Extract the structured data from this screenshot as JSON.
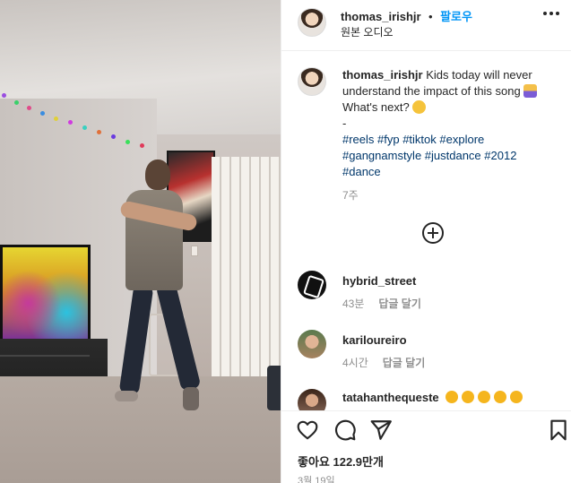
{
  "post": {
    "username": "thomas_irishjr",
    "follow_label": "팔로우",
    "audio_label": "원본 오디오"
  },
  "caption": {
    "username": "thomas_irishjr",
    "text_line1": "Kids today will never understand the impact of this song",
    "text_line2": "What's next?",
    "dash": "-",
    "hashtags": "#reels #fyp #tiktok #explore #gangnamstyle #justdance #2012 #dance",
    "time": "7주"
  },
  "comments": [
    {
      "username": "hybrid_street",
      "time": "43분",
      "reply_label": "답글 달기"
    },
    {
      "username": "kariloureiro",
      "time": "4시간",
      "reply_label": "답글 달기"
    },
    {
      "username": "tatahanthequeste",
      "time": "",
      "reply_label": ""
    }
  ],
  "actions": {
    "likes": "좋아요 122.9만개",
    "date": "3월 19일"
  },
  "icons": {
    "more": "more-horizontal-icon",
    "load_more": "plus-circle-icon",
    "like": "heart-icon",
    "comment": "comment-bubble-icon",
    "share": "paper-plane-icon",
    "save": "bookmark-icon"
  }
}
